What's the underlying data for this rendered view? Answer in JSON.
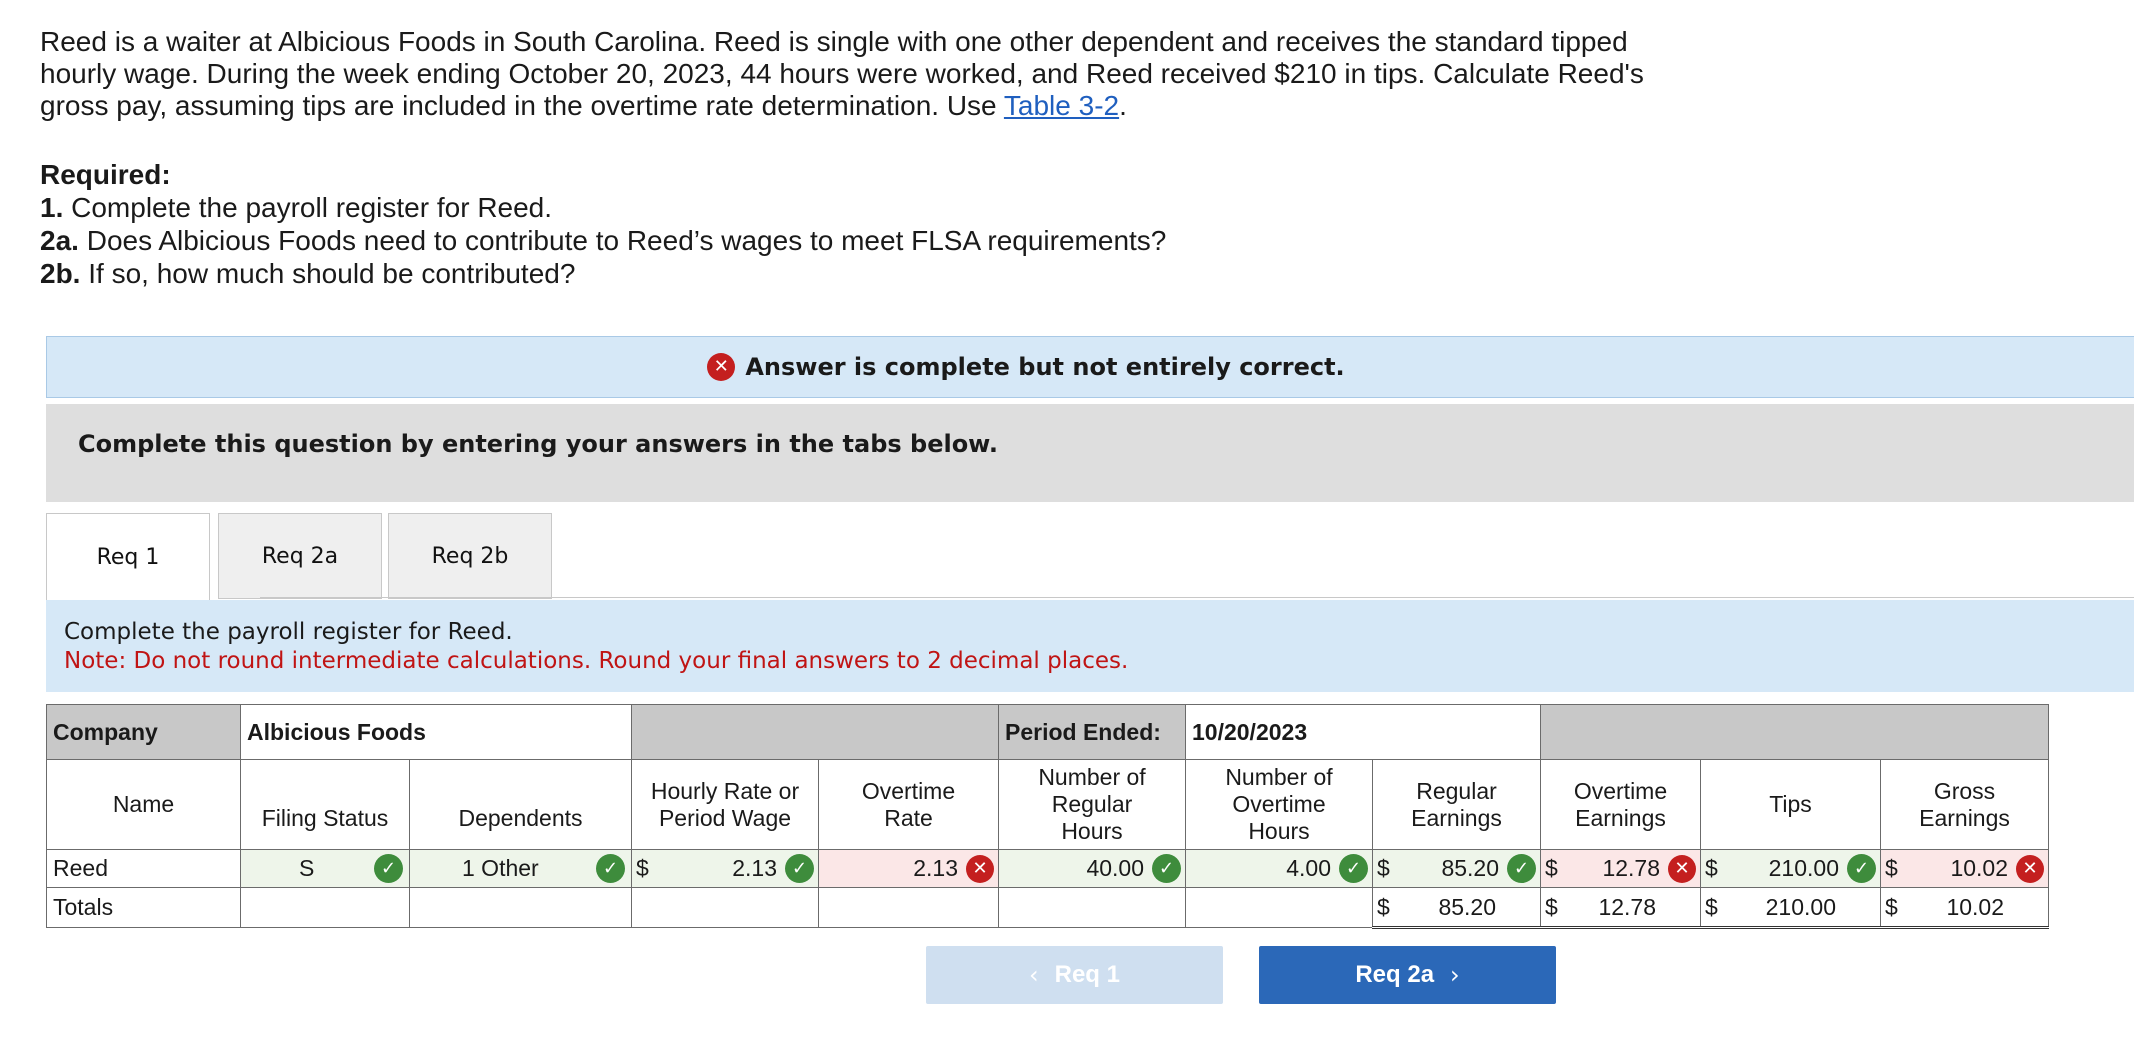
{
  "question": {
    "text_before_link": "Reed is a waiter at Albicious Foods in South Carolina. Reed is single with one other dependent and receives the standard tipped hourly wage. During the week ending October 20, 2023, 44 hours were worked, and Reed received $210 in tips. Calculate Reed's gross pay, assuming tips are included in the overtime rate determination. Use ",
    "link_text": "Table 3-2",
    "text_after_link": "."
  },
  "required": {
    "heading": "Required:",
    "items": [
      {
        "num": "1.",
        "text": " Complete the payroll register for Reed."
      },
      {
        "num": "2a.",
        "text": " Does Albicious Foods need to contribute to Reed’s wages to meet FLSA requirements?"
      },
      {
        "num": "2b.",
        "text": " If so, how much should be contributed?"
      }
    ]
  },
  "banner": {
    "text": "Answer is complete but not entirely correct.",
    "icon": "x-circle-icon"
  },
  "instructions_box": {
    "text": "Complete this question by entering your answers in the tabs below."
  },
  "tabs": [
    {
      "label": "Req 1",
      "active": true
    },
    {
      "label": "Req 2a",
      "active": false
    },
    {
      "label": "Req 2b",
      "active": false
    }
  ],
  "req1": {
    "instruction": "Complete the payroll register for Reed.",
    "note": "Note: Do not round intermediate calculations. Round your final answers to 2 decimal places."
  },
  "register": {
    "company_label": "Company",
    "company_value": "Albicious Foods",
    "period_label": "Period Ended:",
    "period_value": "10/20/2023",
    "headers": {
      "name": "Name",
      "filing_status": "Filing Status",
      "dependents": "Dependents",
      "hourly_rate": "Hourly Rate or Period Wage",
      "overtime_rate": "Overtime Rate",
      "regular_hours": "Number of Regular Hours",
      "overtime_hours": "Number of Overtime Hours",
      "regular_earnings": "Regular Earnings",
      "overtime_earnings": "Overtime Earnings",
      "tips": "Tips",
      "gross_earnings": "Gross Earnings"
    },
    "row": {
      "name": "Reed",
      "filing_status": "S",
      "dependents": "1 Other",
      "hourly_rate": "2.13",
      "overtime_rate": "2.13",
      "regular_hours": "40.00",
      "overtime_hours": "4.00",
      "regular_earnings": "85.20",
      "overtime_earnings": "12.78",
      "tips": "210.00",
      "gross_earnings": "10.02"
    },
    "totals": {
      "label": "Totals",
      "regular_earnings": "85.20",
      "overtime_earnings": "12.78",
      "tips": "210.00",
      "gross_earnings": "10.02"
    },
    "currency": "$",
    "correct_color": "#3e8c3c",
    "incorrect_color": "#c41f1f"
  },
  "nav": {
    "prev_label": "Req 1",
    "next_label": "Req 2a"
  }
}
